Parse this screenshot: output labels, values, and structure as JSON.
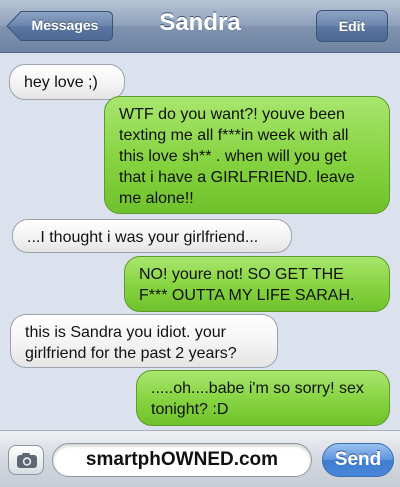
{
  "header": {
    "back_label": "Messages",
    "title": "Sandra",
    "edit_label": "Edit"
  },
  "messages": [
    {
      "direction": "in",
      "text": "hey love ;)"
    },
    {
      "direction": "out",
      "text": "WTF do you want?! youve been texting me all f***in week with all this love sh** . when will you get that i have a GIRLFRIEND. leave me alone!!"
    },
    {
      "direction": "in",
      "text": "...I thought i was your girlfriend..."
    },
    {
      "direction": "out",
      "text": "NO! youre not! SO GET THE F*** OUTTA MY LIFE SARAH."
    },
    {
      "direction": "in",
      "text": "this is Sandra you idiot. your girlfriend for the past 2 years?"
    },
    {
      "direction": "out",
      "text": ".....oh....babe i'm so sorry! sex tonight? :D"
    }
  ],
  "composer": {
    "input_value": "smartphOWNED.com",
    "send_label": "Send",
    "camera_icon": "camera-icon"
  },
  "colors": {
    "header": "#8fa2bc",
    "incoming_bubble": "#f2f2f2",
    "outgoing_bubble": "#86d340",
    "background": "#dbe2ed",
    "send_button": "#4a86d8"
  }
}
